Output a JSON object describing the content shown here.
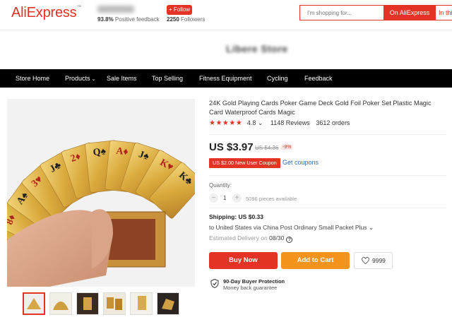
{
  "header": {
    "logo": "AliExpress",
    "feedback_percent": "93.8%",
    "feedback_label": "Positive feedback",
    "follow_label": "+ Follow",
    "followers_count": "2250",
    "followers_label": "Followers",
    "search_placeholder": "I'm shopping for...",
    "search_button": "On AliExpress",
    "search_button2": "In this store"
  },
  "banner": {
    "store_title": "Libere Store"
  },
  "nav": {
    "items": [
      "Store Home",
      "Products",
      "Sale Items",
      "Top Selling",
      "Fitness Equipment",
      "Cycling",
      "Feedback"
    ]
  },
  "product": {
    "title": "24K Gold Playing Cards Poker Game Deck Gold Foil Poker Set Plastic Magic Card Waterproof Cards Magic",
    "stars": "★★★★★",
    "rating": "4.8",
    "reviews": "1148 Reviews",
    "orders": "3612 orders",
    "price": "US $3.97",
    "original_price": "US $4.36",
    "discount": "-9%",
    "coupon": "US $2.00 New User Coupon",
    "coupon_link": "Get coupons",
    "quantity_label": "Quantity:",
    "quantity_value": "1",
    "quantity_available": "5096 pieces available",
    "shipping_title": "Shipping: US $0.33",
    "shipping_detail": "to United States via China Post Ordinary Small Packet Plus",
    "delivery_label": "Estimated Delivery on",
    "delivery_date": "08/30",
    "buy_now": "Buy Now",
    "add_to_cart": "Add to Cart",
    "wishlist_count": "9999",
    "protection_title": "90-Day Buyer Protection",
    "protection_detail": "Money back guarantee"
  },
  "colors": {
    "brand_red": "#e43225",
    "cart_orange": "#f5941d",
    "nav_black": "#000000",
    "link_blue": "#2e6fba"
  }
}
